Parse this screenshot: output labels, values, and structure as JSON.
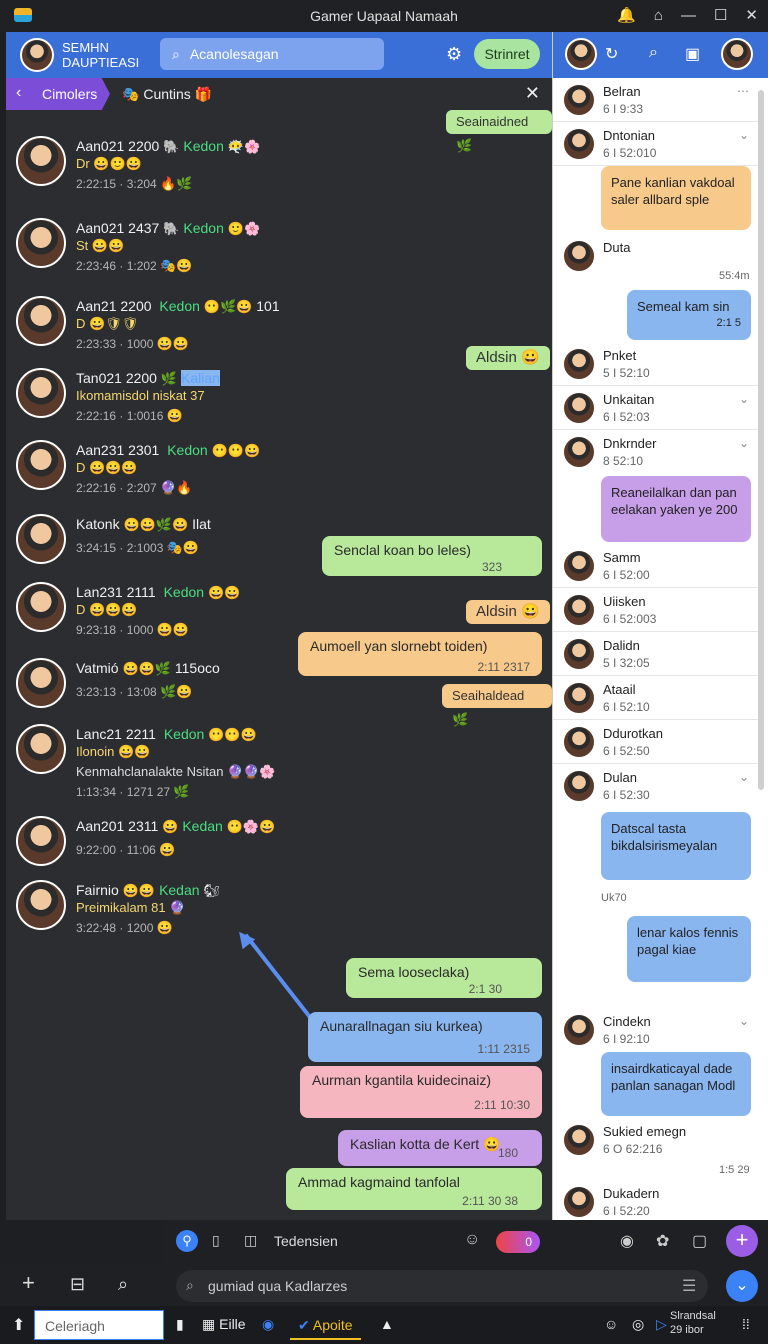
{
  "window": {
    "title": "Gamer Uapaal Namaah",
    "controls": [
      "—",
      "☐",
      "✕"
    ]
  },
  "topbar": {
    "name_line1": "SEMHN",
    "name_line2": "DAUPTIEASI",
    "search_placeholder": "Acanolesagan",
    "stream_label": "Strinret"
  },
  "subbar": {
    "crumb": "Cimolers",
    "channel": "Cuntins"
  },
  "members": [
    {
      "name": "Aan021 2200",
      "role": "Kedon",
      "role_color": "green",
      "line2": "Dr",
      "line3": "2:22:15 · 3:204"
    },
    {
      "name": "Aan021 2437",
      "role": "Kedon",
      "role_color": "green",
      "line2": "St",
      "line3": "2:23:46 · 1:202"
    },
    {
      "name": "Aan21 2200",
      "role": "Kedon",
      "role_color": "green",
      "line2": "D",
      "line3": "2:23:33 · 1000",
      "extra": "101"
    },
    {
      "name": "Tan021 2200",
      "role": "Kalian",
      "role_color": "blue",
      "line2": "Ikomamisdol  niskat",
      "line3": "2:22:16 · 1:0016",
      "extra": "37"
    },
    {
      "name": "Aan231 2301",
      "role": "Kedon",
      "role_color": "green",
      "line2": "D",
      "line3": "2:22:16 · 2:207"
    },
    {
      "name": "Katonk",
      "role": "",
      "role_color": "green",
      "line2": "",
      "line3": "3:24:15 · 2:1003",
      "extra": "Ilat"
    },
    {
      "name": "Lan231 2111",
      "role": "Kedon",
      "role_color": "green",
      "line2": "D",
      "line3": "9:23:18 · 1000"
    },
    {
      "name": "Vatmió",
      "role": "",
      "role_color": "green",
      "line2": "",
      "line3": "3:23:13 · 13:08",
      "extra": "115oco"
    },
    {
      "name": "Lanc21 2211",
      "role": "Kedon",
      "role_color": "green",
      "line2": "Ilonoin",
      "line3": "Kenmahclanalakte Nsitan",
      "line4": "1:13:34 · 1271  27"
    },
    {
      "name": "Aan201 2311",
      "role": "Kedan",
      "role_color": "green",
      "line2": "",
      "line3": "9:22:00 · 11:06"
    },
    {
      "name": "Fairnio",
      "role": "Kedan",
      "role_color": "green",
      "line2": "Preimikalam  81",
      "line3": "3:22:48 · 1200"
    }
  ],
  "chat_bubbles": [
    {
      "text": "Seainaidned",
      "type": "tag",
      "color": "green"
    },
    {
      "text": "Aldsin",
      "type": "tag",
      "color": "green"
    },
    {
      "text": "Senclal koan bo leles)",
      "meta": "323",
      "color": "green"
    },
    {
      "text": "Aldsin",
      "type": "tag",
      "color": "orange"
    },
    {
      "text": "Aumoell yan slornebt toiden)",
      "meta": "2:11  2317",
      "color": "orange"
    },
    {
      "text": "Seaihaldead",
      "type": "tag",
      "color": "orange"
    },
    {
      "text": "Sema looseclaka)",
      "meta": "2:1 30",
      "color": "green"
    },
    {
      "text": "Aunarallnagan siu kurkea)",
      "meta": "1:11  2315",
      "color": "blue"
    },
    {
      "text": "Aurman kgantila kuidecinaiz)",
      "meta": "2:11  10:30",
      "color": "pink"
    },
    {
      "text": "Kaslian kotta de Kert",
      "meta": "180",
      "color": "purple"
    },
    {
      "text": "Ammad kagmaind tanfolal",
      "meta": "2:11  30  38",
      "color": "green"
    }
  ],
  "compose": {
    "label": "Tedensien",
    "toggle_value": "0"
  },
  "message_input": {
    "placeholder": "gumiad qua Kadlarzes"
  },
  "taskbar": {
    "search": "Celeriagh",
    "item_file": "Eille",
    "item_apps": "Apoite",
    "tray_line1": "Slrandsal",
    "tray_line2": "29 ibor"
  },
  "right_panel": {
    "conversations": [
      {
        "name": "Belran",
        "sub": "6 I 9:33"
      },
      {
        "name": "Dntonian",
        "sub": "6 I 52:010"
      },
      {
        "name": "Duta",
        "sub": ""
      },
      {
        "name": "Pnket",
        "sub": "5 I 52:10"
      },
      {
        "name": "Unkaitan",
        "sub": "6 I 52:03"
      },
      {
        "name": "Dnkrnder",
        "sub": "8 52:10"
      },
      {
        "name": "Samm",
        "sub": "6 I 52:00"
      },
      {
        "name": "Uiisken",
        "sub": "6 I 52:003"
      },
      {
        "name": "Dalidn",
        "sub": "5 I 32:05"
      },
      {
        "name": "Ataail",
        "sub": "6 I 52:10"
      },
      {
        "name": "Ddurotkan",
        "sub": "6 I 52:50"
      },
      {
        "name": "Dulan",
        "sub": "6 I 52:30"
      },
      {
        "name": "Cindekn",
        "sub": "6 I 92:10"
      },
      {
        "name": "Sukied emegn",
        "sub": "6 O 62:216"
      },
      {
        "name": "Dukadern",
        "sub": "6 I 52:20"
      }
    ],
    "bubbles": [
      {
        "text": "Pane kanlian vakdoal saler allbard sple",
        "color": "orange"
      },
      {
        "text": "Semeal kam sin",
        "meta": "2:1 5",
        "color": "blue"
      },
      {
        "text": "Reaneilalkan dan pan eelakan yaken ye 200",
        "color": "purple"
      },
      {
        "text": "Datscal tasta bikdalsirismeyalan",
        "color": "blue"
      },
      {
        "text": "lenar kalos fennis pagal kiae",
        "color": "blue"
      },
      {
        "text": "insairdkaticayal dade panlan sanagan Modl",
        "color": "blue"
      }
    ],
    "times": [
      "55:4m",
      "Uk70",
      "1:5 29"
    ]
  }
}
